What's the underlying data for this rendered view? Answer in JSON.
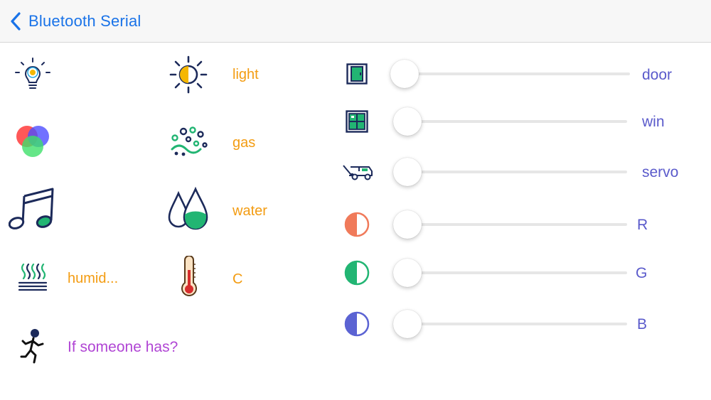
{
  "navbar": {
    "back_label": "Bluetooth Serial",
    "accent": "#1a73e8"
  },
  "sensors": [
    {
      "icon": "bulb-icon",
      "label": ""
    },
    {
      "icon": "sun-icon",
      "label": "light"
    },
    {
      "icon": "rgb-circles-icon",
      "label": ""
    },
    {
      "icon": "gas-icon",
      "label": "gas"
    },
    {
      "icon": "music-note-icon",
      "label": ""
    },
    {
      "icon": "water-drops-icon",
      "label": "water"
    },
    {
      "icon": "humidity-icon",
      "label": "humid..."
    },
    {
      "icon": "thermometer-icon",
      "label": "C"
    },
    {
      "icon": "running-person-icon",
      "label": "If someone has?"
    }
  ],
  "controls": [
    {
      "icon": "door-icon",
      "label": "door",
      "value": 0
    },
    {
      "icon": "window-icon",
      "label": "win",
      "value": 0
    },
    {
      "icon": "servo-icon",
      "label": "servo",
      "value": 0
    },
    {
      "icon": "red-half-circle-icon",
      "label": "R",
      "value": 0,
      "color": "#f07a5a"
    },
    {
      "icon": "green-half-circle-icon",
      "label": "G",
      "value": 0,
      "color": "#22b573"
    },
    {
      "icon": "blue-half-circle-icon",
      "label": "B",
      "value": 0,
      "color": "#5b63d3"
    }
  ],
  "colors": {
    "orange_label": "#f39c12",
    "purple_label": "#b045d4",
    "blue_label": "#5a5acb"
  }
}
